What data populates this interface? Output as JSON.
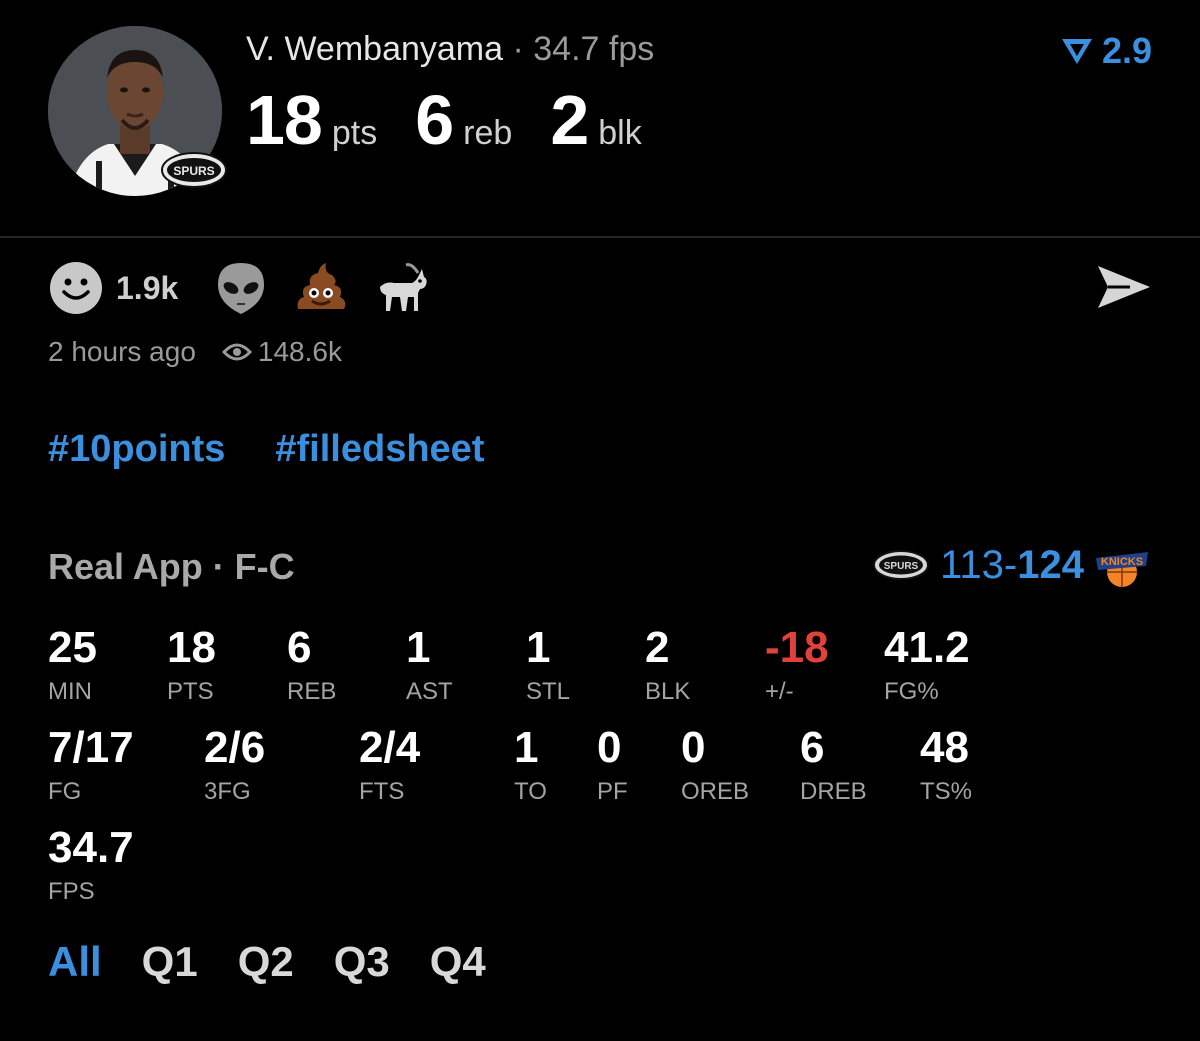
{
  "player": {
    "name": "V. Wembanyama",
    "separator": "·",
    "fps_text": "34.7 fps",
    "team_badge_text": "SPURS"
  },
  "headline_stats": [
    {
      "value": "18",
      "unit": "pts"
    },
    {
      "value": "6",
      "unit": "reb"
    },
    {
      "value": "2",
      "unit": "blk"
    }
  ],
  "rating": {
    "value": "2.9",
    "icon": "rating-arrow-icon",
    "color": "#3b8fdf"
  },
  "reactions": {
    "count": "1.9k",
    "emojis": [
      "smiley-icon",
      "alien-icon",
      "poop-icon",
      "goat-icon"
    ]
  },
  "meta": {
    "time": "2 hours ago",
    "views": "148.6k"
  },
  "hashtags": [
    "#10points",
    "#filledsheet"
  ],
  "source": {
    "label": "Real App · F-C"
  },
  "score": {
    "home": "113",
    "dash": "-",
    "away": "124",
    "home_team": "SPURS",
    "away_team": "KNICKS"
  },
  "stats": {
    "row1": [
      {
        "value": "25",
        "label": "MIN"
      },
      {
        "value": "18",
        "label": "PTS"
      },
      {
        "value": "6",
        "label": "REB"
      },
      {
        "value": "1",
        "label": "AST"
      },
      {
        "value": "1",
        "label": "STL"
      },
      {
        "value": "2",
        "label": "BLK"
      },
      {
        "value": "-18",
        "label": "+/-"
      },
      {
        "value": "41.2",
        "label": "FG%"
      }
    ],
    "row2": [
      {
        "value": "7/17",
        "label": "FG"
      },
      {
        "value": "2/6",
        "label": "3FG"
      },
      {
        "value": "2/4",
        "label": "FTS"
      },
      {
        "value": "1",
        "label": "TO"
      },
      {
        "value": "0",
        "label": "PF"
      },
      {
        "value": "0",
        "label": "OREB"
      },
      {
        "value": "6",
        "label": "DREB"
      },
      {
        "value": "48",
        "label": "TS%"
      }
    ],
    "row3": [
      {
        "value": "34.7",
        "label": "FPS"
      }
    ]
  },
  "quarters": {
    "tabs": [
      "All",
      "Q1",
      "Q2",
      "Q3",
      "Q4"
    ],
    "active": "All"
  },
  "colors": {
    "accent": "#3b8fdf",
    "negative": "#e0413a",
    "background": "#000000"
  }
}
